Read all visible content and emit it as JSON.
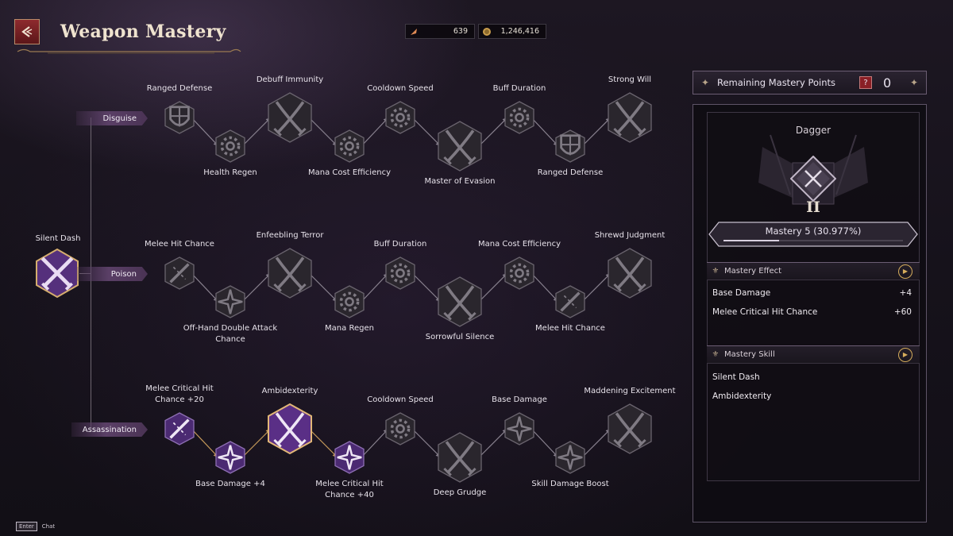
{
  "header": {
    "title": "Weapon Mastery",
    "currencies": [
      {
        "icon": "feather-token-icon",
        "value": "639"
      },
      {
        "icon": "gold-coin-icon",
        "value": "1,246,416"
      }
    ]
  },
  "tree": {
    "root": {
      "label": "Silent Dash"
    },
    "branches": [
      {
        "name": "Disguise",
        "nodes": [
          {
            "label": "Ranged Defense"
          },
          {
            "label": "Health Regen"
          },
          {
            "label": "Debuff Immunity"
          },
          {
            "label": "Mana Cost Efficiency"
          },
          {
            "label": "Cooldown Speed"
          },
          {
            "label": "Master of Evasion"
          },
          {
            "label": "Buff Duration"
          },
          {
            "label": "Ranged Defense"
          },
          {
            "label": "Strong Will"
          }
        ]
      },
      {
        "name": "Poison",
        "nodes": [
          {
            "label": "Melee Hit Chance"
          },
          {
            "label": "Off-Hand Double Attack Chance",
            "line1": "Off-Hand Double Attack",
            "line2": "Chance"
          },
          {
            "label": "Enfeebling Terror"
          },
          {
            "label": "Mana Regen"
          },
          {
            "label": "Buff Duration"
          },
          {
            "label": "Sorrowful Silence"
          },
          {
            "label": "Mana Cost Efficiency"
          },
          {
            "label": "Melee Hit Chance"
          },
          {
            "label": "Shrewd Judgment"
          }
        ]
      },
      {
        "name": "Assassination",
        "nodes": [
          {
            "label": "Melee Critical Hit Chance +20",
            "line1": "Melee Critical Hit",
            "line2": "Chance +20"
          },
          {
            "label": "Base Damage  +4"
          },
          {
            "label": "Ambidexterity"
          },
          {
            "label": "Melee Critical Hit Chance +40",
            "line1": "Melee Critical Hit",
            "line2": "Chance +40"
          },
          {
            "label": "Cooldown Speed"
          },
          {
            "label": "Deep Grudge"
          },
          {
            "label": "Base Damage"
          },
          {
            "label": "Skill Damage Boost"
          },
          {
            "label": "Maddening Excitement"
          }
        ]
      }
    ]
  },
  "panel": {
    "remaining_label": "Remaining Mastery Points",
    "remaining_value": "0",
    "weapon_name": "Dagger",
    "rank_numeral": "II",
    "mastery_text": "Mastery 5  (30.977%)",
    "mastery_progress": 0.30977,
    "effect_header": "Mastery Effect",
    "effects": [
      {
        "name": "Base Damage",
        "value": "+4"
      },
      {
        "name": "Melee Critical Hit Chance",
        "value": "+60"
      }
    ],
    "skill_header": "Mastery Skill",
    "skills": [
      "Silent Dash",
      "Ambidexterity"
    ]
  },
  "footer": {
    "key": "Enter",
    "label": "Chat"
  },
  "colors": {
    "accent_gold": "#c79a5a",
    "active_purple": "#5a2f86",
    "panel_border": "#5e5467"
  }
}
